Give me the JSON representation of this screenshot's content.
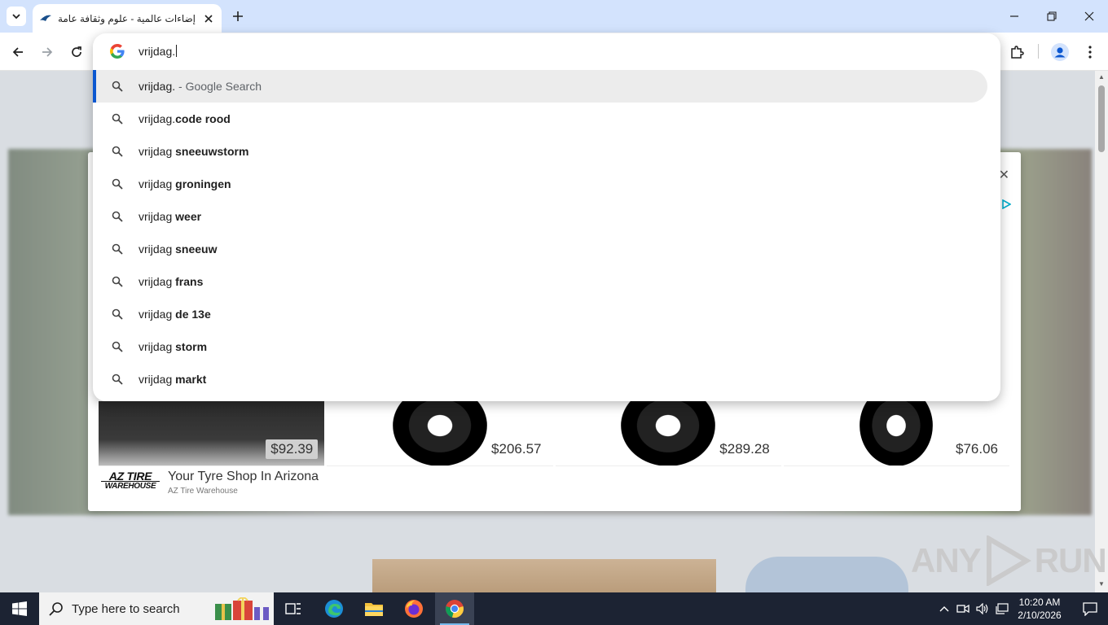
{
  "browser": {
    "tab": {
      "title": "إضاءات عالمية - علوم وثقافة عامة"
    },
    "omnibox": {
      "query": "vrijdag.",
      "suggestions": [
        {
          "prefix": "vrijdag.",
          "bold": "",
          "desc": " - Google Search"
        },
        {
          "prefix": "vrijdag.",
          "bold": "code rood",
          "desc": ""
        },
        {
          "prefix": "vrijdag ",
          "bold": "sneeuwstorm",
          "desc": ""
        },
        {
          "prefix": "vrijdag ",
          "bold": "groningen",
          "desc": ""
        },
        {
          "prefix": "vrijdag ",
          "bold": "weer",
          "desc": ""
        },
        {
          "prefix": "vrijdag ",
          "bold": "sneeuw",
          "desc": ""
        },
        {
          "prefix": "vrijdag ",
          "bold": "frans",
          "desc": ""
        },
        {
          "prefix": "vrijdag ",
          "bold": "de 13e",
          "desc": ""
        },
        {
          "prefix": "vrijdag ",
          "bold": "storm",
          "desc": ""
        },
        {
          "prefix": "vrijdag ",
          "bold": "markt",
          "desc": ""
        }
      ]
    }
  },
  "ad": {
    "prices": [
      "$92.39",
      "$206.57",
      "$289.28",
      "$76.06"
    ],
    "brand_logo_line1": "AZ TIRE",
    "brand_logo_line2": "WAREHOUSE",
    "headline": "Your Tyre Shop In Arizona",
    "advertiser": "AZ Tire Warehouse"
  },
  "taskbar": {
    "search_placeholder": "Type here to search",
    "time": "10:20 AM",
    "date": "2/10/2026"
  },
  "watermark": {
    "text_left": "ANY",
    "text_right": "RUN"
  },
  "colors": {
    "accent": "#0b57d0",
    "tabstrip": "#d3e3fd",
    "taskbar": "#1c2333"
  }
}
